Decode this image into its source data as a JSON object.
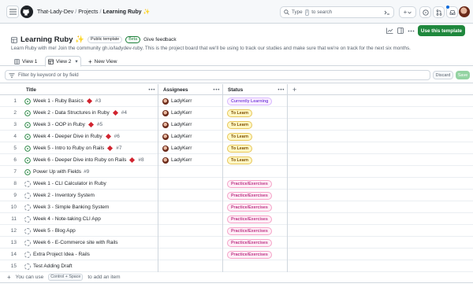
{
  "header": {
    "breadcrumb": [
      "That-Lady-Dev",
      "Projects",
      "Learning Ruby ✨"
    ],
    "search_prefix": "Type",
    "search_key": "/",
    "search_suffix": "to search",
    "plus_label": "+"
  },
  "project": {
    "title": "Learning Ruby ✨",
    "template_badge": "Public template",
    "beta_badge": "Beta",
    "feedback_link": "Give feedback",
    "description": "Learn Ruby with me! Join the community gh.io/ladydev-ruby. This is the project board that we'll be using to track our studies and make sure that we're on track for the next six months.",
    "use_template_button": "Use this template"
  },
  "tabs": [
    {
      "label": "View 1"
    },
    {
      "label": "View 2"
    },
    {
      "label": "New View"
    }
  ],
  "filter": {
    "placeholder": "Filter by keyword or by field",
    "discard": "Discard",
    "save": "Save"
  },
  "table": {
    "columns": [
      "Title",
      "Assignees",
      "Status"
    ],
    "rows": [
      {
        "num": "1",
        "title": "Week 1 - Ruby Basics",
        "ruby": true,
        "issue": "#3",
        "type": "open",
        "assignee": "LadyKerr",
        "status": "Currently Learning",
        "status_kind": "learning"
      },
      {
        "num": "2",
        "title": "Week 2 - Data Structures in Ruby",
        "ruby": true,
        "issue": "#4",
        "type": "open",
        "assignee": "LadyKerr",
        "status": "To Learn",
        "status_kind": "tolearn"
      },
      {
        "num": "3",
        "title": "Week 3 - OOP in Ruby",
        "ruby": true,
        "issue": "#5",
        "type": "open",
        "assignee": "LadyKerr",
        "status": "To Learn",
        "status_kind": "tolearn"
      },
      {
        "num": "4",
        "title": "Week 4 - Deeper Dive in Ruby",
        "ruby": true,
        "issue": "#6",
        "type": "open",
        "assignee": "LadyKerr",
        "status": "To Learn",
        "status_kind": "tolearn"
      },
      {
        "num": "5",
        "title": "Week 5 - Intro to Ruby on Rails",
        "ruby": true,
        "issue": "#7",
        "type": "open",
        "assignee": "LadyKerr",
        "status": "To Learn",
        "status_kind": "tolearn"
      },
      {
        "num": "6",
        "title": "Week 6 - Deeper Dive into Ruby on Rails",
        "ruby": true,
        "issue": "#8",
        "type": "open",
        "assignee": "LadyKerr",
        "status": "To Learn",
        "status_kind": "tolearn"
      },
      {
        "num": "7",
        "title": "Power Up with Fields",
        "ruby": false,
        "issue": "#9",
        "type": "open",
        "assignee": "",
        "status": "",
        "status_kind": ""
      },
      {
        "num": "8",
        "title": "Week 1 - CLI Calculator in Ruby",
        "ruby": false,
        "issue": "",
        "type": "draft",
        "assignee": "",
        "status": "Practice/Exercises",
        "status_kind": "practice"
      },
      {
        "num": "9",
        "title": "Week 2 - Inventory System",
        "ruby": false,
        "issue": "",
        "type": "draft",
        "assignee": "",
        "status": "Practice/Exercises",
        "status_kind": "practice"
      },
      {
        "num": "10",
        "title": "Week 3 - Simple Banking System",
        "ruby": false,
        "issue": "",
        "type": "draft",
        "assignee": "",
        "status": "Practice/Exercises",
        "status_kind": "practice"
      },
      {
        "num": "11",
        "title": "Week 4 - Note-taking CLI App",
        "ruby": false,
        "issue": "",
        "type": "draft",
        "assignee": "",
        "status": "Practice/Exercises",
        "status_kind": "practice"
      },
      {
        "num": "12",
        "title": "Week 5 - Blog App",
        "ruby": false,
        "issue": "",
        "type": "draft",
        "assignee": "",
        "status": "Practice/Exercises",
        "status_kind": "practice"
      },
      {
        "num": "13",
        "title": "Week 6 - E-Commerce site with Rails",
        "ruby": false,
        "issue": "",
        "type": "draft",
        "assignee": "",
        "status": "Practice/Exercises",
        "status_kind": "practice"
      },
      {
        "num": "14",
        "title": "Extra Project Idea - Rails",
        "ruby": false,
        "issue": "",
        "type": "draft",
        "assignee": "",
        "status": "Practice/Exercises",
        "status_kind": "practice"
      },
      {
        "num": "15",
        "title": "Test Adding Draft",
        "ruby": false,
        "issue": "",
        "type": "draft",
        "assignee": "",
        "status": "",
        "status_kind": ""
      }
    ],
    "add_item": {
      "prefix": "You can use",
      "shortcut": "Control + Space",
      "suffix": "to add an item"
    }
  },
  "colors": {
    "accent_green": "#1f883d",
    "open_icon": "#1a7f37",
    "ruby_red": "#d1242f",
    "border": "#d0d7de"
  }
}
